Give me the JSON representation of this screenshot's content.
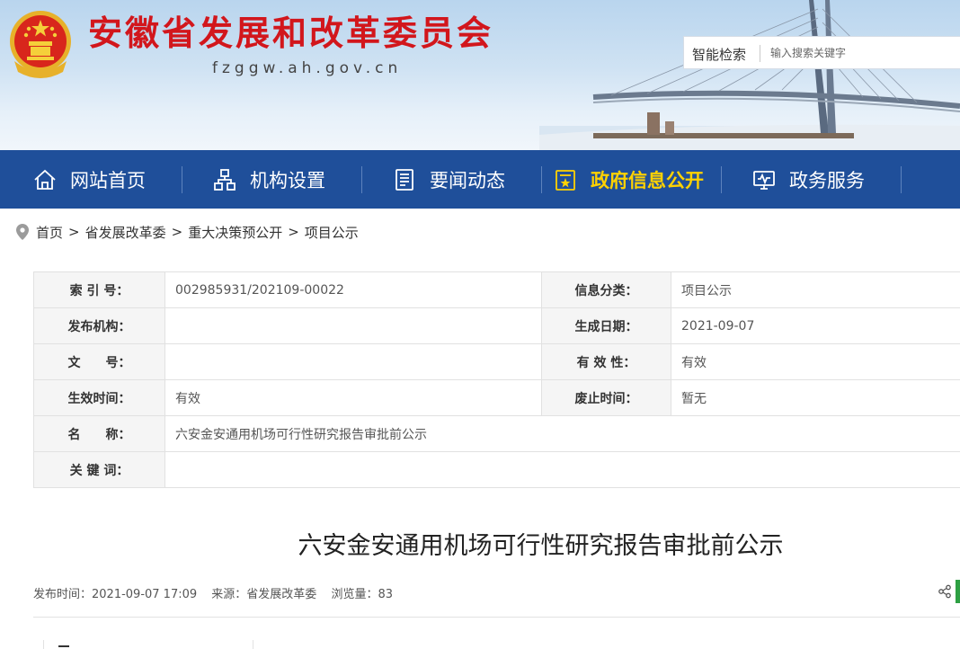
{
  "header": {
    "site_title": "安徽省发展和改革委员会",
    "site_domain": "fzggw.ah.gov.cn"
  },
  "search": {
    "label": "智能检索",
    "placeholder": "输入搜索关键字"
  },
  "nav": {
    "items": [
      {
        "label": "网站首页",
        "icon": "home-icon"
      },
      {
        "label": "机构设置",
        "icon": "org-chart-icon"
      },
      {
        "label": "要闻动态",
        "icon": "news-icon"
      },
      {
        "label": "政府信息公开",
        "icon": "info-disclosure-icon"
      },
      {
        "label": "政务服务",
        "icon": "monitor-icon"
      }
    ],
    "active_index": 3,
    "active_color": "#ffd200",
    "bar_color": "#1f4f9a"
  },
  "breadcrumb": {
    "items": [
      "首页",
      "省发展改革委",
      "重大决策预公开",
      "项目公示"
    ],
    "separator": ">"
  },
  "meta": {
    "index_no_label": "索 引 号：",
    "index_no": "002985931/202109-00022",
    "category_label": "信息分类：",
    "category": "项目公示",
    "publisher_label": "发布机构：",
    "publisher": "",
    "created_label": "生成日期：",
    "created": "2021-09-07",
    "doc_no_label": "文　　号：",
    "doc_no": "",
    "validity_label": "有 效 性：",
    "validity": "有效",
    "effective_label": "生效时间：",
    "effective": "有效",
    "expiry_label": "废止时间：",
    "expiry": "暂无",
    "name_label": "名　　称：",
    "name": "六安金安通用机场可行性研究报告审批前公示",
    "keywords_label": "关 键 词：",
    "keywords": ""
  },
  "article": {
    "title": "六安金安通用机场可行性研究报告审批前公示",
    "publish_time": "发布时间：2021-09-07 17:09",
    "source": "来源：省发展改革委",
    "views": "浏览量：83"
  }
}
